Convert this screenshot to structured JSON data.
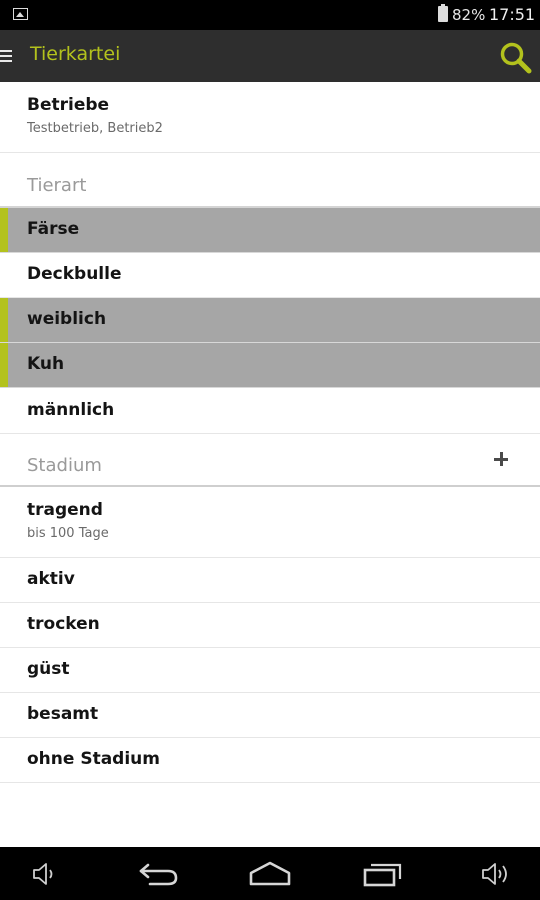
{
  "status_bar": {
    "battery_percent": "82%",
    "time": "17:51",
    "icons": [
      "image-notification-icon",
      "battery-icon"
    ]
  },
  "action_bar": {
    "title": "Tierkartei",
    "icons": [
      "menu-icon",
      "search-icon"
    ]
  },
  "colors": {
    "accent": "#b3c21d",
    "action_bar": "#2e2e2e",
    "selected_row": "#a6a6a6"
  },
  "betriebe": {
    "title": "Betriebe",
    "subtitle": "Testbetrieb, Betrieb2"
  },
  "tierart": {
    "header": "Tierart",
    "items": [
      {
        "label": "Färse",
        "selected": true
      },
      {
        "label": "Deckbulle",
        "selected": false
      },
      {
        "label": "weiblich",
        "selected": true
      },
      {
        "label": "Kuh",
        "selected": true
      },
      {
        "label": "männlich",
        "selected": false
      }
    ]
  },
  "stadium": {
    "header": "Stadium",
    "add_icon": "plus-icon",
    "items": [
      {
        "label": "tragend",
        "subtitle": "bis 100 Tage"
      },
      {
        "label": "aktiv"
      },
      {
        "label": "trocken"
      },
      {
        "label": "güst"
      },
      {
        "label": "besamt"
      },
      {
        "label": "ohne Stadium"
      }
    ]
  },
  "nav_bar": {
    "icons": [
      "volume-down-icon",
      "back-icon",
      "home-icon",
      "recent-apps-icon",
      "volume-up-icon"
    ]
  }
}
